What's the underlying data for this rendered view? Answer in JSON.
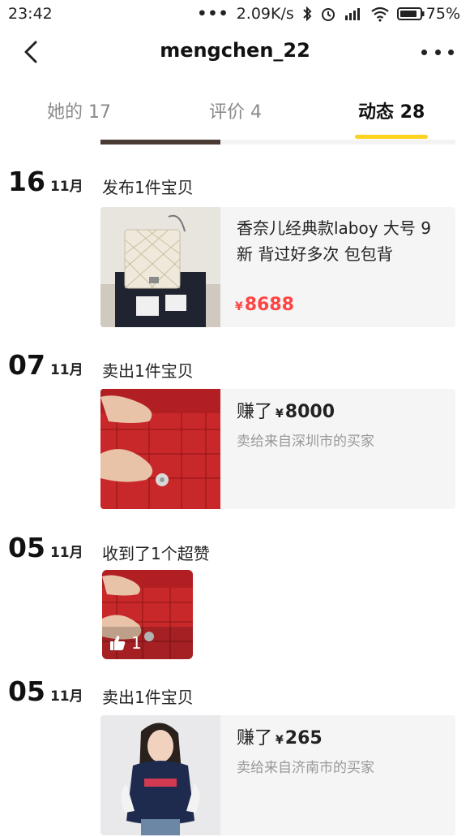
{
  "status_bar": {
    "time": "23:42",
    "net_speed": "2.09K/s",
    "battery": "75%"
  },
  "nav": {
    "title": "mengchen_22"
  },
  "tabs": [
    {
      "label": "她的 17",
      "active": false
    },
    {
      "label": "评价 4",
      "active": false
    },
    {
      "label": "动态 28",
      "active": true
    }
  ],
  "feed": [
    {
      "day": "16",
      "month": "11月",
      "action": "发布1件宝贝",
      "title": "香奈儿经典款laboy 大号 9新 背过好多次 包包背",
      "currency": "¥",
      "price": "8688"
    },
    {
      "day": "07",
      "month": "11月",
      "action": "卖出1件宝贝",
      "earn_prefix": "赚了",
      "currency": "¥",
      "amount": "8000",
      "buyer": "卖给来自深圳市的买家"
    },
    {
      "day": "05",
      "month": "11月",
      "action": "收到了1个超赞",
      "like_count": "1"
    },
    {
      "day": "05",
      "month": "11月",
      "action": "卖出1件宝贝",
      "earn_prefix": "赚了",
      "currency": "¥",
      "amount": "265",
      "buyer": "卖给来自济南市的买家"
    }
  ],
  "colors": {
    "accent": "#ffd21e",
    "price": "#ff4444",
    "muted": "#999999",
    "card_bg": "#f5f5f5"
  }
}
